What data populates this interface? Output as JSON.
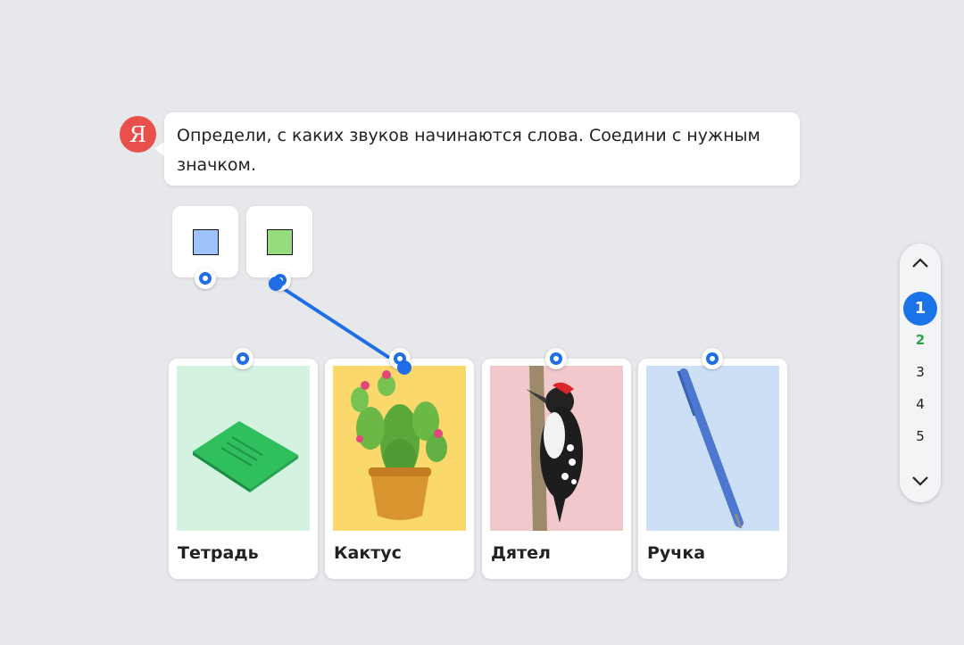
{
  "assistant": {
    "avatar_letter": "Я",
    "avatar_color": "#e94f4b"
  },
  "task": {
    "text": "Определи, с каких звуков начинаются слова. Соедини с нужным значком."
  },
  "symbols": [
    {
      "name": "blue-square",
      "color": "#9dc3fa"
    },
    {
      "name": "green-square",
      "color": "#97db7f"
    }
  ],
  "words": [
    {
      "label": "Тетрадь",
      "icon": "notebook-picture",
      "bg": "#d4f2e0"
    },
    {
      "label": "Кактус",
      "icon": "cactus-picture",
      "bg": "#fbd86c"
    },
    {
      "label": "Дятел",
      "icon": "woodpecker-picture",
      "bg": "#f1c9cd"
    },
    {
      "label": "Ручка",
      "icon": "pen-picture",
      "bg": "#cddff5"
    }
  ],
  "connections": [
    {
      "from": "green-square",
      "to": "Кактус"
    }
  ],
  "pager": {
    "up_icon": "chevron-up-icon",
    "down_icon": "chevron-down-icon",
    "pages": [
      "1",
      "2",
      "3",
      "4",
      "5"
    ],
    "current": "1",
    "completed": [
      "2"
    ],
    "accent": "#1a73e8",
    "done_color": "#2ea24a"
  }
}
